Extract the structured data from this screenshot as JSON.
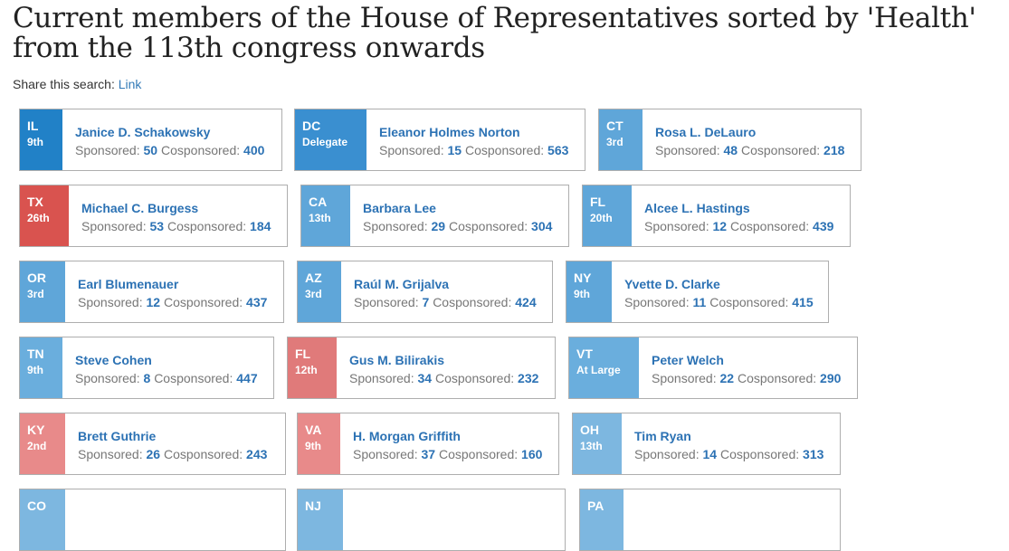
{
  "header": {
    "title": "Current members of the House of Representatives sorted by 'Health' from the 113th congress onwards",
    "share_label": "Share this search:",
    "share_link": "Link"
  },
  "labels": {
    "sponsored": "Sponsored:",
    "cosponsored": "Cosponsored:"
  },
  "colors": {
    "dem_dark": "#2181c7",
    "dem_mid": "#3a8fd0",
    "dem_light": "#5fa6d9",
    "dem_pale": "#7db7e0",
    "rep_dark": "#d9534f",
    "rep_mid": "#e07a7a",
    "rep_light": "#e88a8a"
  },
  "members": [
    {
      "state": "IL",
      "district": "9th",
      "name": "Janice D. Schakowsky",
      "sponsored": "50",
      "cosponsored": "400"
    },
    {
      "state": "DC",
      "district": "Delegate",
      "name": "Eleanor Holmes Norton",
      "sponsored": "15",
      "cosponsored": "563"
    },
    {
      "state": "CT",
      "district": "3rd",
      "name": "Rosa L. DeLauro",
      "sponsored": "48",
      "cosponsored": "218"
    },
    {
      "state": "TX",
      "district": "26th",
      "name": "Michael C. Burgess",
      "sponsored": "53",
      "cosponsored": "184"
    },
    {
      "state": "CA",
      "district": "13th",
      "name": "Barbara Lee",
      "sponsored": "29",
      "cosponsored": "304"
    },
    {
      "state": "FL",
      "district": "20th",
      "name": "Alcee L. Hastings",
      "sponsored": "12",
      "cosponsored": "439"
    },
    {
      "state": "OR",
      "district": "3rd",
      "name": "Earl Blumenauer",
      "sponsored": "12",
      "cosponsored": "437"
    },
    {
      "state": "AZ",
      "district": "3rd",
      "name": "Raúl M. Grijalva",
      "sponsored": "7",
      "cosponsored": "424"
    },
    {
      "state": "NY",
      "district": "9th",
      "name": "Yvette D. Clarke",
      "sponsored": "11",
      "cosponsored": "415"
    },
    {
      "state": "TN",
      "district": "9th",
      "name": "Steve Cohen",
      "sponsored": "8",
      "cosponsored": "447"
    },
    {
      "state": "FL",
      "district": "12th",
      "name": "Gus M. Bilirakis",
      "sponsored": "34",
      "cosponsored": "232"
    },
    {
      "state": "VT",
      "district": "At Large",
      "name": "Peter Welch",
      "sponsored": "22",
      "cosponsored": "290"
    },
    {
      "state": "KY",
      "district": "2nd",
      "name": "Brett Guthrie",
      "sponsored": "26",
      "cosponsored": "243"
    },
    {
      "state": "VA",
      "district": "9th",
      "name": "H. Morgan Griffith",
      "sponsored": "37",
      "cosponsored": "160"
    },
    {
      "state": "OH",
      "district": "13th",
      "name": "Tim Ryan",
      "sponsored": "14",
      "cosponsored": "313"
    },
    {
      "state": "CO",
      "district": "",
      "name": "",
      "sponsored": "",
      "cosponsored": ""
    },
    {
      "state": "NJ",
      "district": "",
      "name": "",
      "sponsored": "",
      "cosponsored": ""
    },
    {
      "state": "PA",
      "district": "",
      "name": "",
      "sponsored": "",
      "cosponsored": ""
    }
  ]
}
